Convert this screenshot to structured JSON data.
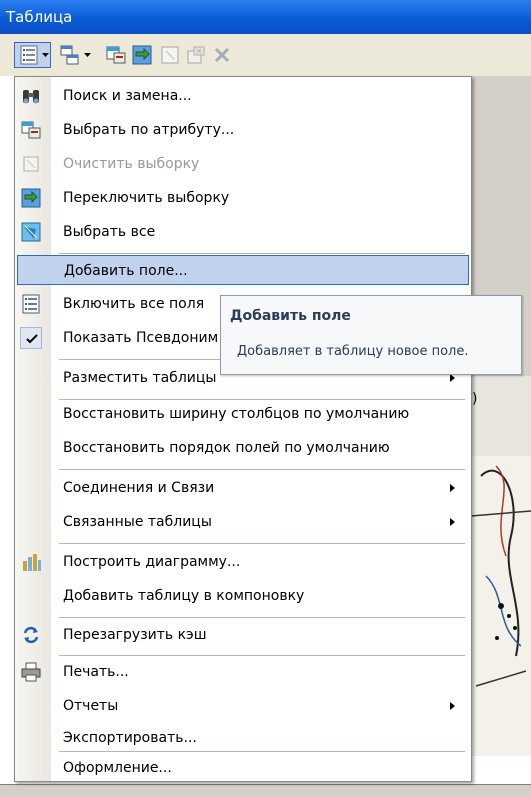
{
  "window": {
    "title": "Таблица"
  },
  "toolbar": {
    "buttons": [
      {
        "name": "table-options",
        "icon": "table-options-icon"
      },
      {
        "name": "related-tables",
        "icon": "related-tables-icon"
      },
      {
        "name": "select-by-attributes",
        "icon": "select-by-attributes-icon"
      },
      {
        "name": "switch-selection",
        "icon": "switch-selection-icon"
      },
      {
        "name": "clear-selection",
        "icon": "clear-selection-icon"
      },
      {
        "name": "zoom-to-selected",
        "icon": "zoom-selected-icon"
      },
      {
        "name": "delete-selected",
        "icon": "delete-icon"
      }
    ]
  },
  "menu": {
    "items": [
      {
        "label": "Поиск и замена...",
        "icon": "binoculars-icon"
      },
      {
        "label": "Выбрать по атрибуту...",
        "icon": "select-by-attributes-icon"
      },
      {
        "label": "Очистить выборку",
        "icon": "clear-selection-icon",
        "disabled": true
      },
      {
        "label": "Переключить выборку",
        "icon": "switch-selection-icon"
      },
      {
        "label": "Выбрать все",
        "icon": "select-all-icon"
      },
      {
        "label": "Добавить поле...",
        "highlighted": true
      },
      {
        "label": "Включить все поля",
        "icon": "fields-list-icon"
      },
      {
        "label": "Показать Псевдоним",
        "icon": "check-icon",
        "checked": true
      },
      {
        "label": "Разместить таблицы",
        "submenu": true
      },
      {
        "label": "Восстановить ширину столбцов по умолчанию"
      },
      {
        "label": "Восстановить порядок полей по умолчанию"
      },
      {
        "label": "Соединения и Связи",
        "submenu": true
      },
      {
        "label": "Связанные таблицы",
        "submenu": true
      },
      {
        "label": "Построить диаграмму...",
        "icon": "bar-chart-icon"
      },
      {
        "label": "Добавить таблицу в компоновку"
      },
      {
        "label": "Перезагрузить кэш",
        "icon": "refresh-icon"
      },
      {
        "label": "Печать...",
        "icon": "printer-icon"
      },
      {
        "label": "Отчеты",
        "submenu": true
      },
      {
        "label": "Экспортировать..."
      },
      {
        "label": "Оформление..."
      }
    ]
  },
  "tooltip": {
    "title": "Добавить поле",
    "body": "Добавляет в таблицу новое поле."
  },
  "background": {
    "closing_paren": ")"
  },
  "colors": {
    "highlight": "#c1d2ee",
    "highlight_border": "#316ac5",
    "titlebar": "#0b5cd7"
  }
}
